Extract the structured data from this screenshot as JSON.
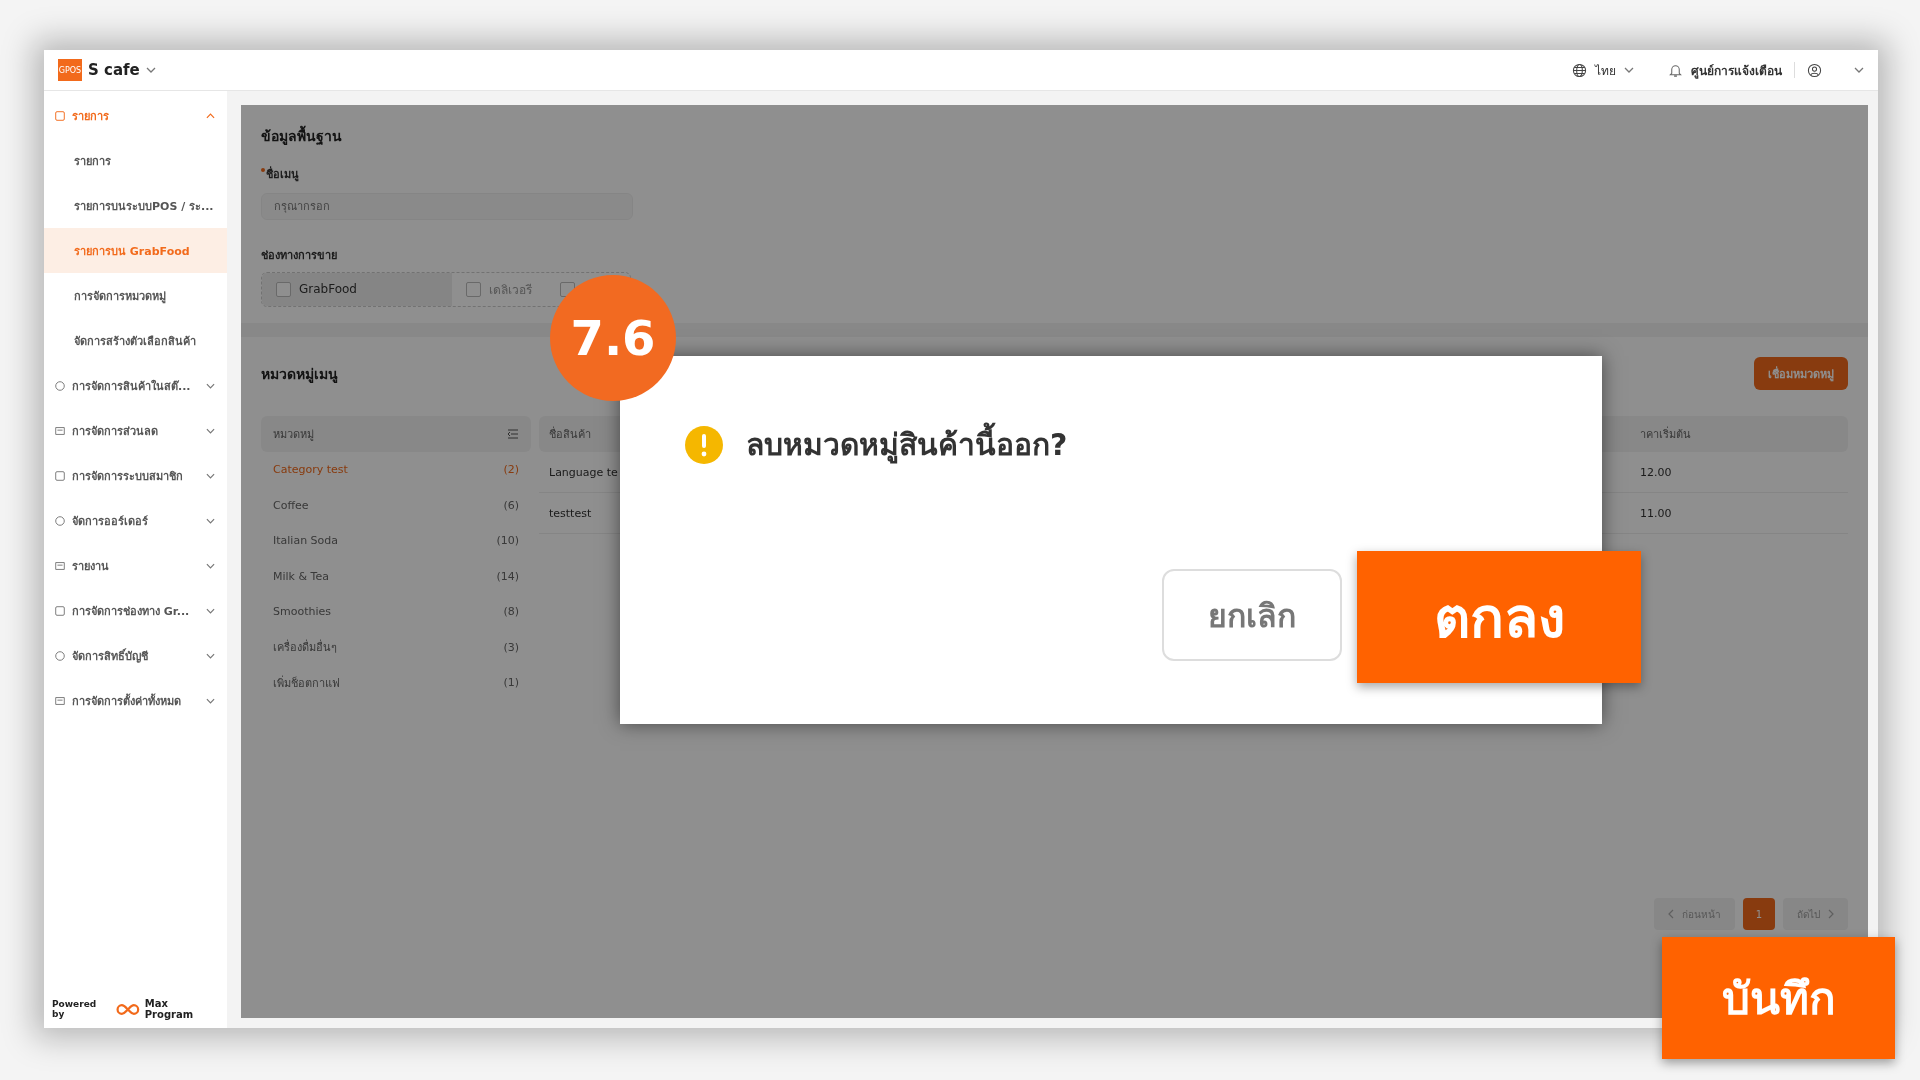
{
  "app": {
    "logo": "GPOS",
    "store": "S cafe",
    "language": "ไทย",
    "notifications": "ศูนย์การแจ้งเตือน"
  },
  "sidebar": {
    "items": [
      {
        "label": "รายการ",
        "expanded": true,
        "selected": true,
        "children": [
          {
            "label": "รายการ",
            "selected": false
          },
          {
            "label": "รายการบนระบบPOS / ระ...",
            "selected": false
          },
          {
            "label": "รายการบน GrabFood",
            "selected": true
          },
          {
            "label": "การจัดการหมวดหมู่",
            "selected": false
          },
          {
            "label": "จัดการสร้างตัวเลือกสินค้า",
            "selected": false
          }
        ]
      },
      {
        "label": "การจัดการสินค้าในสต๊...",
        "expanded": false,
        "selected": false
      },
      {
        "label": "การจัดการส่วนลด",
        "expanded": false,
        "selected": false
      },
      {
        "label": "การจัดการระบบสมาชิก",
        "expanded": false,
        "selected": false
      },
      {
        "label": "จัดการออร์เดอร์",
        "expanded": false,
        "selected": false
      },
      {
        "label": "รายงาน",
        "expanded": false,
        "selected": false
      },
      {
        "label": "การจัดการช่องทาง Gr...",
        "expanded": false,
        "selected": false
      },
      {
        "label": "จัดการสิทธิ์บัญชี",
        "expanded": false,
        "selected": false
      },
      {
        "label": "การจัดการตั้งค่าทั้งหมด",
        "expanded": false,
        "selected": false
      }
    ],
    "powered_by": "Powered by",
    "brand": "Max Program"
  },
  "form": {
    "section": "ข้อมูลพื้นฐาน",
    "name_label": "ชื่อเมนู",
    "name_required": true,
    "name_placeholder": "กรุณากรอก",
    "channel_label": "ช่องทางการขาย",
    "channels": [
      {
        "label": "GrabFood",
        "checked": false,
        "selected": true
      },
      {
        "label": "เดลิเวอรี",
        "checked": false,
        "selected": false
      },
      {
        "checked": false,
        "selected": false
      }
    ]
  },
  "categories": {
    "title": "หมวดหมู่เมนู",
    "link_button": "เชื่อมหมวดหมู่",
    "column": "หมวดหมู่",
    "items": [
      {
        "name": "Category test",
        "count": "(2)",
        "selected": true
      },
      {
        "name": "Coffee",
        "count": "(6)",
        "selected": false
      },
      {
        "name": "Italian Soda",
        "count": "(10)",
        "selected": false
      },
      {
        "name": "Milk & Tea",
        "count": "(14)",
        "selected": false
      },
      {
        "name": "Smoothies",
        "count": "(8)",
        "selected": false
      },
      {
        "name": "เครื่องดื่มอื่นๆ",
        "count": "(3)",
        "selected": false
      },
      {
        "name": "เพิ่มช็อตกาแฟ",
        "count": "(1)",
        "selected": false
      }
    ],
    "product_columns": [
      "ชื่อสินค้า",
      "าคาเริ่มต้น"
    ],
    "rows": [
      {
        "name": "Language te",
        "price": "12.00"
      },
      {
        "name": "testtest",
        "price": "11.00"
      }
    ]
  },
  "pagination": {
    "previous": "ก่อนหน้า",
    "pages": [
      {
        "label": "1",
        "selected": true
      }
    ],
    "next": "ถัดไป"
  },
  "dialog": {
    "title": "ลบหมวดหมู่สินค้านี้ออก?",
    "cancel": "ยกเลิก",
    "ok": "ตกลง"
  },
  "step": "7.6",
  "save_button": "บันทึก"
}
